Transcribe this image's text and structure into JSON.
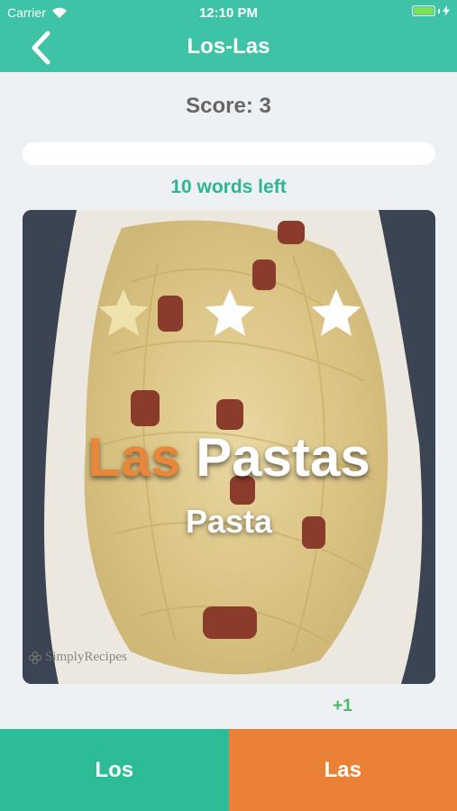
{
  "status_bar": {
    "carrier": "Carrier",
    "time": "12:10 PM",
    "battery_level": 1.0,
    "battery_color": "#7de05a",
    "icons": [
      "wifi-icon",
      "battery-icon",
      "charging-bolt-icon"
    ]
  },
  "nav": {
    "title": "Los-Las",
    "back_icon": "chevron-left-icon"
  },
  "quiz": {
    "score_text": "Score: 3",
    "progress_fraction": 0.0,
    "words_left_text": "10 words left",
    "stars_total": 3,
    "stars_filled": 1,
    "article": "Las",
    "noun": "Pastas",
    "translation": "Pasta",
    "watermark": "SimplyRecipes",
    "points_delta": "+1"
  },
  "answers": {
    "los_label": "Los",
    "las_label": "Las"
  },
  "colors": {
    "accent_teal": "#3ec3a6",
    "los_button": "#2cbc98",
    "las_button": "#e98236",
    "article_orange": "#e8863a",
    "star_filled": "#efe3ad",
    "star_empty": "#ffffff",
    "delta_green": "#4db868"
  }
}
